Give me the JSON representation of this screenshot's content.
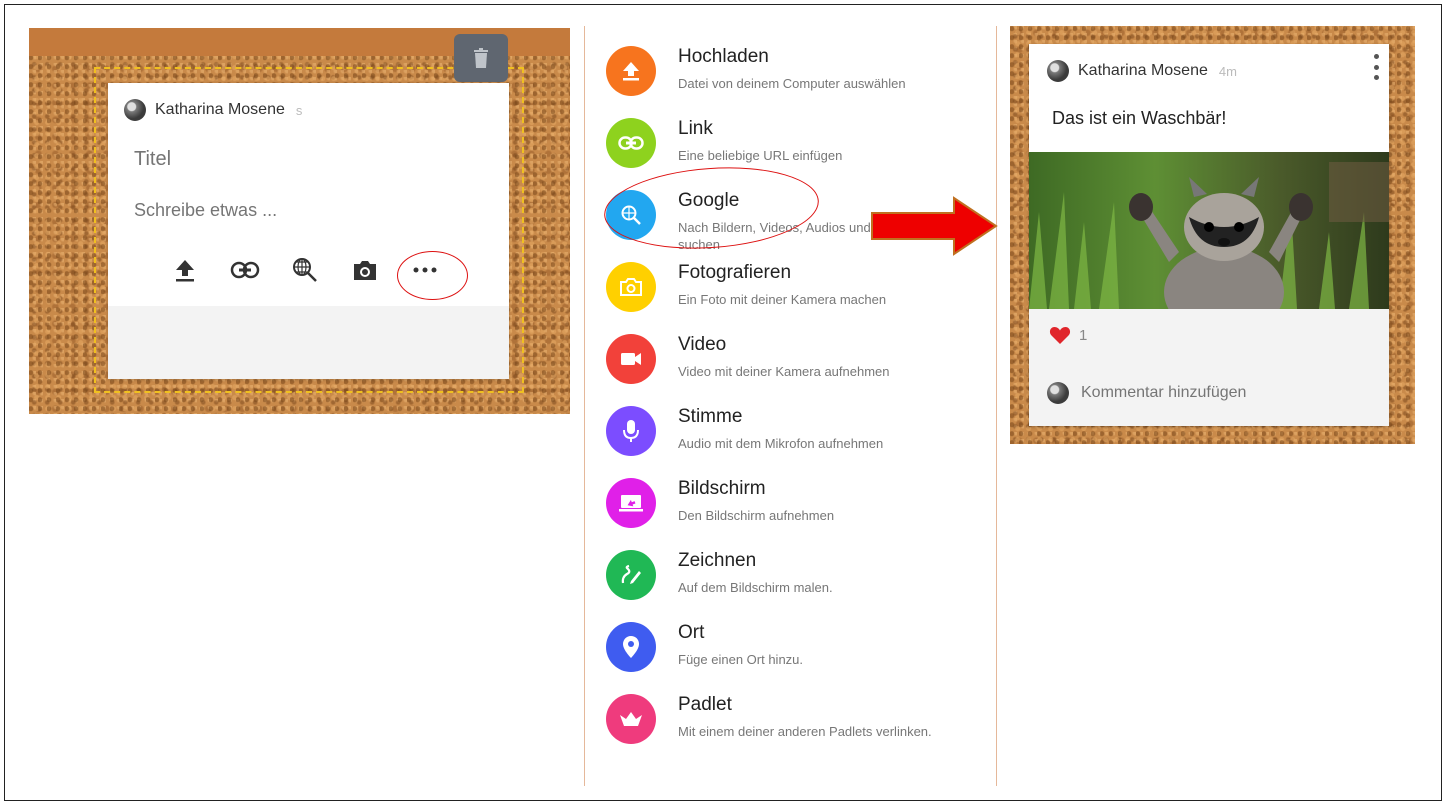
{
  "compose": {
    "author": "Katharina Mosene",
    "time": "s",
    "title_placeholder": "Titel",
    "body_placeholder": "Schreibe etwas ..."
  },
  "menu": {
    "items": [
      {
        "label": "Hochladen",
        "desc": "Datei von deinem Computer auswählen",
        "color": "#f7741e",
        "icon": "upload-icon"
      },
      {
        "label": "Link",
        "desc": "Eine beliebige URL einfügen",
        "color": "#8ed21e",
        "icon": "link-icon"
      },
      {
        "label": "Google",
        "desc": "Nach Bildern, Videos, Audios und Webseiten suchen",
        "color": "#22a7f0",
        "icon": "web-search-icon"
      },
      {
        "label": "Fotografieren",
        "desc": "Ein Foto mit deiner Kamera machen",
        "color": "#ffd000",
        "icon": "camera-icon"
      },
      {
        "label": "Video",
        "desc": "Video mit deiner Kamera aufnehmen",
        "color": "#f2413a",
        "icon": "video-camera-icon"
      },
      {
        "label": "Stimme",
        "desc": "Audio mit dem Mikrofon aufnehmen",
        "color": "#7c4dff",
        "icon": "microphone-icon"
      },
      {
        "label": "Bildschirm",
        "desc": "Den Bildschirm aufnehmen",
        "color": "#e020e8",
        "icon": "screen-record-icon"
      },
      {
        "label": "Zeichnen",
        "desc": "Auf dem Bildschirm malen.",
        "color": "#20b855",
        "icon": "draw-icon"
      },
      {
        "label": "Ort",
        "desc": "Füge einen Ort hinzu.",
        "color": "#3f5cf0",
        "icon": "location-pin-icon"
      },
      {
        "label": "Padlet",
        "desc": "Mit einem deiner anderen Padlets verlinken.",
        "color": "#ef3b7d",
        "icon": "padlet-icon"
      }
    ]
  },
  "post": {
    "author": "Katharina Mosene",
    "time": "4m",
    "text": "Das ist ein Waschbär!",
    "likes": "1",
    "comment_placeholder": "Kommentar hinzufügen"
  },
  "colors": {
    "highlight_red": "#dd1111",
    "arrow_red": "#ee0000",
    "dashed_frame": "#f0c020",
    "cork": "#c98a4a"
  }
}
